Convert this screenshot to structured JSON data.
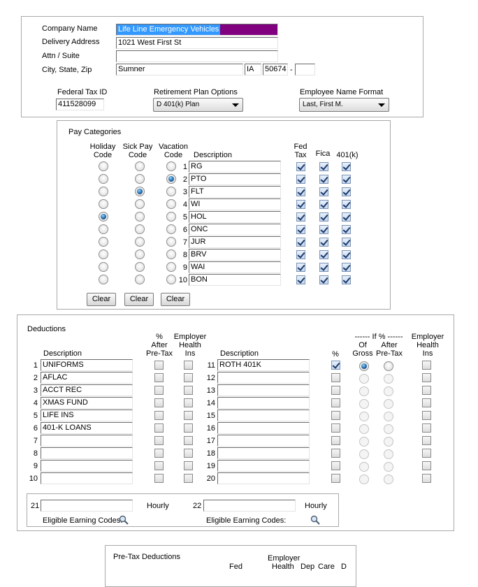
{
  "company": {
    "name_label": "Company Name",
    "name_value": "Life Line Emergency Vehicles",
    "address_label": "Delivery Address",
    "address_value": "1021 West First St",
    "attn_label": "Attn / Suite",
    "attn_value": "",
    "city_label": "City, State, Zip",
    "city_value": "Sumner",
    "state_value": "IA",
    "zip_value": "50674",
    "zip_dash": "-",
    "zip_ext_value": "",
    "tax_id_label": "Federal Tax ID",
    "tax_id_value": "411528099",
    "retirement_label": "Retirement Plan Options",
    "retirement_value": "D 401(k) Plan",
    "name_format_label": "Employee Name Format",
    "name_format_value": "Last, First M."
  },
  "pay_categories": {
    "title": "Pay Categories",
    "headers": {
      "holiday": "Holiday\nCode",
      "sick": "Sick Pay\nCode",
      "vacation": "Vacation\nCode",
      "description": "Description",
      "fed_tax": "Fed\nTax",
      "fica": "Fica",
      "k401": "401(k)"
    },
    "rows": [
      {
        "num": "1",
        "desc": "RG",
        "holiday": false,
        "sick": false,
        "vacation": false,
        "fed": true,
        "fica": true,
        "k401": true
      },
      {
        "num": "2",
        "desc": "PTO",
        "holiday": false,
        "sick": false,
        "vacation": true,
        "fed": true,
        "fica": true,
        "k401": true
      },
      {
        "num": "3",
        "desc": "FLT",
        "holiday": false,
        "sick": true,
        "vacation": false,
        "fed": true,
        "fica": true,
        "k401": true
      },
      {
        "num": "4",
        "desc": "WI",
        "holiday": false,
        "sick": false,
        "vacation": false,
        "fed": true,
        "fica": true,
        "k401": true
      },
      {
        "num": "5",
        "desc": "HOL",
        "holiday": true,
        "sick": false,
        "vacation": false,
        "fed": true,
        "fica": true,
        "k401": true
      },
      {
        "num": "6",
        "desc": "ONC",
        "holiday": false,
        "sick": false,
        "vacation": false,
        "fed": true,
        "fica": true,
        "k401": true
      },
      {
        "num": "7",
        "desc": "JUR",
        "holiday": false,
        "sick": false,
        "vacation": false,
        "fed": true,
        "fica": true,
        "k401": true
      },
      {
        "num": "8",
        "desc": "BRV",
        "holiday": false,
        "sick": false,
        "vacation": false,
        "fed": true,
        "fica": true,
        "k401": true
      },
      {
        "num": "9",
        "desc": "WAI",
        "holiday": false,
        "sick": false,
        "vacation": false,
        "fed": true,
        "fica": true,
        "k401": true
      },
      {
        "num": "10",
        "desc": "BON",
        "holiday": false,
        "sick": false,
        "vacation": false,
        "fed": true,
        "fica": true,
        "k401": true
      }
    ],
    "clear_label": "Clear"
  },
  "deductions": {
    "title": "Deductions",
    "headers": {
      "description": "Description",
      "after_pretax": "%\nAfter\nPre-Tax",
      "employer_health": "Employer\nHealth\nIns",
      "description2": "Description",
      "percent": "%",
      "if_percent": "------ If % ------",
      "of_gross": "Of\nGross",
      "after_pretax2": "After\nPre-Tax",
      "employer_health2": "Employer\nHealth\nIns"
    },
    "left_rows": [
      {
        "num": "1",
        "desc": "UNIFORMS",
        "after": false,
        "health": false
      },
      {
        "num": "2",
        "desc": "AFLAC",
        "after": false,
        "health": false
      },
      {
        "num": "3",
        "desc": "ACCT REC",
        "after": false,
        "health": false
      },
      {
        "num": "4",
        "desc": "XMAS FUND",
        "after": false,
        "health": false
      },
      {
        "num": "5",
        "desc": "LIFE INS",
        "after": false,
        "health": false
      },
      {
        "num": "6",
        "desc": "401-K LOANS",
        "after": false,
        "health": false
      },
      {
        "num": "7",
        "desc": "",
        "after": false,
        "health": false
      },
      {
        "num": "8",
        "desc": "",
        "after": false,
        "health": false
      },
      {
        "num": "9",
        "desc": "",
        "after": false,
        "health": false
      },
      {
        "num": "10",
        "desc": "",
        "after": false,
        "health": false
      }
    ],
    "right_rows": [
      {
        "num": "11",
        "desc": "ROTH 401K",
        "percent": true,
        "gross": true,
        "after": false,
        "health": false,
        "enabled": true
      },
      {
        "num": "12",
        "desc": "",
        "percent": false,
        "gross": false,
        "after": false,
        "health": false,
        "enabled": false
      },
      {
        "num": "13",
        "desc": "",
        "percent": false,
        "gross": false,
        "after": false,
        "health": false,
        "enabled": false
      },
      {
        "num": "14",
        "desc": "",
        "percent": false,
        "gross": false,
        "after": false,
        "health": false,
        "enabled": false
      },
      {
        "num": "15",
        "desc": "",
        "percent": false,
        "gross": false,
        "after": false,
        "health": false,
        "enabled": false
      },
      {
        "num": "16",
        "desc": "",
        "percent": false,
        "gross": false,
        "after": false,
        "health": false,
        "enabled": false
      },
      {
        "num": "17",
        "desc": "",
        "percent": false,
        "gross": false,
        "after": false,
        "health": false,
        "enabled": false
      },
      {
        "num": "18",
        "desc": "",
        "percent": false,
        "gross": false,
        "after": false,
        "health": false,
        "enabled": false
      },
      {
        "num": "19",
        "desc": "",
        "percent": false,
        "gross": false,
        "after": false,
        "health": false,
        "enabled": false
      },
      {
        "num": "20",
        "desc": "",
        "percent": false,
        "gross": false,
        "after": false,
        "health": false,
        "enabled": false
      }
    ],
    "hourly": {
      "num21": "21",
      "num22": "22",
      "value21": "",
      "value22": "",
      "hourly_label": "Hourly",
      "eligible_label": "Eligible Earning Codes:",
      "search_icon": "magnifier-icon"
    }
  },
  "pretax": {
    "title": "Pre-Tax Deductions",
    "employer_label": "Employer",
    "partial_fed": "Fed",
    "partial_health": "Health",
    "partial_dep": "Dep",
    "partial_care": "Care",
    "partial_d": "D"
  },
  "colors": {
    "selection_bg": "#3399ff",
    "field_highlight": "#800080",
    "radio_selected": "#1a5d9e"
  }
}
